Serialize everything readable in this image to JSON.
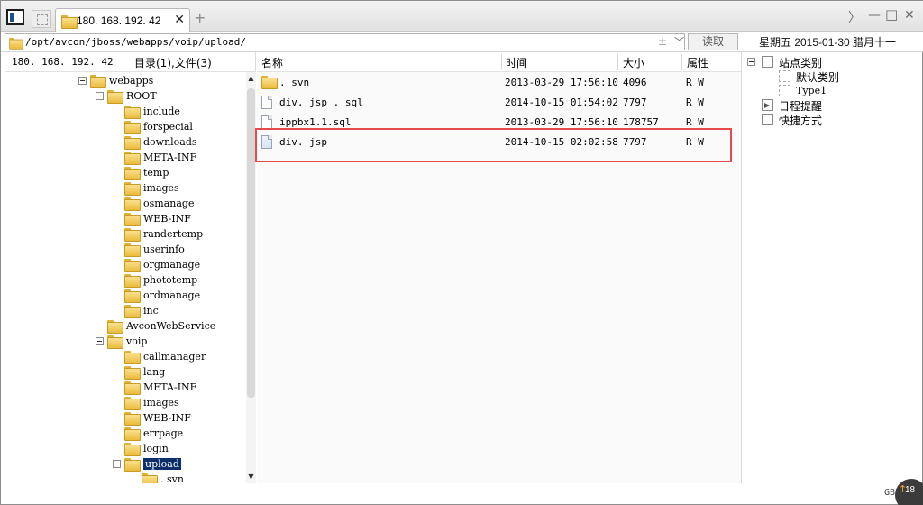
{
  "titlebar": {
    "tab_label": "180. 168. 192. 42",
    "tab_close": "✕",
    "tab_add": "+",
    "controls": {
      "back": "〉",
      "minimize": "—",
      "maximize": "□",
      "close": "✕"
    }
  },
  "pathbar": {
    "path": "/opt/avcon/jboss/webapps/voip/upload/",
    "plus": "±",
    "chevron": "﹀",
    "read_button": "读取",
    "date": "星期五  2015-01-30  腊月十一"
  },
  "left": {
    "ip": "180. 168. 192. 42",
    "counts": "目录(1),文件(3)",
    "tree": [
      {
        "label": "webapps",
        "level": 0,
        "expanded": true,
        "open": true
      },
      {
        "label": "ROOT",
        "level": 1,
        "expanded": true,
        "open": true
      },
      {
        "label": "include",
        "level": 2
      },
      {
        "label": "forspecial",
        "level": 2
      },
      {
        "label": "downloads",
        "level": 2
      },
      {
        "label": "META-INF",
        "level": 2
      },
      {
        "label": "temp",
        "level": 2
      },
      {
        "label": "images",
        "level": 2
      },
      {
        "label": "osmanage",
        "level": 2
      },
      {
        "label": "WEB-INF",
        "level": 2
      },
      {
        "label": "randertemp",
        "level": 2
      },
      {
        "label": "userinfo",
        "level": 2
      },
      {
        "label": "orgmanage",
        "level": 2
      },
      {
        "label": "phototemp",
        "level": 2
      },
      {
        "label": "ordmanage",
        "level": 2
      },
      {
        "label": "inc",
        "level": 2
      },
      {
        "label": "AvconWebService",
        "level": 1
      },
      {
        "label": "voip",
        "level": 1,
        "expanded": true,
        "open": true
      },
      {
        "label": "callmanager",
        "level": 2
      },
      {
        "label": "lang",
        "level": 2
      },
      {
        "label": "META-INF",
        "level": 2
      },
      {
        "label": "images",
        "level": 2
      },
      {
        "label": "WEB-INF",
        "level": 2
      },
      {
        "label": "errpage",
        "level": 2
      },
      {
        "label": "login",
        "level": 2
      },
      {
        "label": "upload",
        "level": 2,
        "expanded": true,
        "open": true,
        "selected": true
      },
      {
        "label": ". svn",
        "level": 3
      }
    ]
  },
  "list": {
    "headers": {
      "name": "名称",
      "time": "时间",
      "size": "大小",
      "attr": "属性"
    },
    "rows": [
      {
        "name": ". svn",
        "time": "2013-03-29 17:56:10",
        "size": "4096",
        "attr": "R W",
        "type": "folder"
      },
      {
        "name": "div. jsp . sql",
        "time": "2014-10-15 01:54:02",
        "size": "7797",
        "attr": "R W",
        "type": "file"
      },
      {
        "name": "ippbx1.1.sql",
        "time": "2013-03-29 17:56:10",
        "size": "178757",
        "attr": "R W",
        "type": "file"
      },
      {
        "name": "div. jsp",
        "time": "2014-10-15 02:02:58",
        "size": "7797",
        "attr": "R W",
        "type": "jsp",
        "highlighted": true
      }
    ]
  },
  "right": {
    "items": [
      {
        "label": "站点类别",
        "level": 0,
        "expanded": true
      },
      {
        "label": "默认类别",
        "level": 1
      },
      {
        "label": "Type1",
        "level": 1
      },
      {
        "label": "日程提醒",
        "level": 0
      },
      {
        "label": "快捷方式",
        "level": 0
      }
    ]
  },
  "corner": {
    "text": "GB2312",
    "badge_count": "18",
    "badge_arrow": "↑"
  },
  "colors": {
    "highlight_border": "#e54b4b",
    "selection_bg": "#0c2e6b",
    "folder_yellow": "#e9bb3c"
  }
}
